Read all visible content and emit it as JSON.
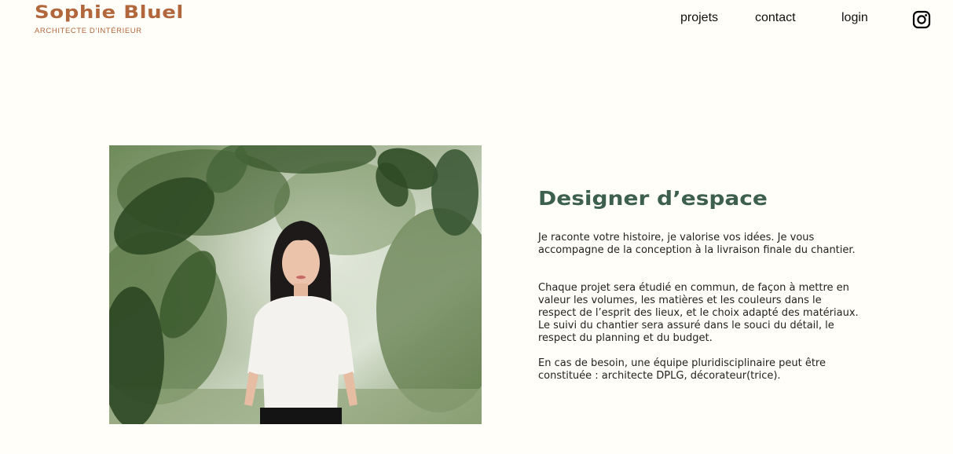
{
  "header": {
    "logo_title": "Sophie Bluel",
    "logo_subtitle": "ARCHITECTE D’INTÉRIEUR",
    "nav": {
      "projets": "projets",
      "contact": "contact",
      "login": "login"
    },
    "instagram_icon": "instagram-icon"
  },
  "colors": {
    "background": "#FFFEF8",
    "brand": "#B1663C",
    "title_green": "#3C5F4F"
  },
  "introduction": {
    "photo_icon": "portrait-photo",
    "title": "Designer d’espace",
    "paragraphs": [
      "Je raconte votre histoire, je valorise vos idées. Je vous accompagne de la conception à la livraison finale du chantier.",
      "Chaque projet sera étudié en commun, de façon à mettre en valeur les volumes, les matières et les couleurs dans le respect de l’esprit des lieux, et le choix adapté des matériaux. Le suivi du chantier sera assuré dans le souci du détail, le respect du planning et du budget.",
      "En cas de besoin, une équipe pluridisciplinaire peut être constituée : architecte DPLG, décorateur(trice)."
    ]
  }
}
